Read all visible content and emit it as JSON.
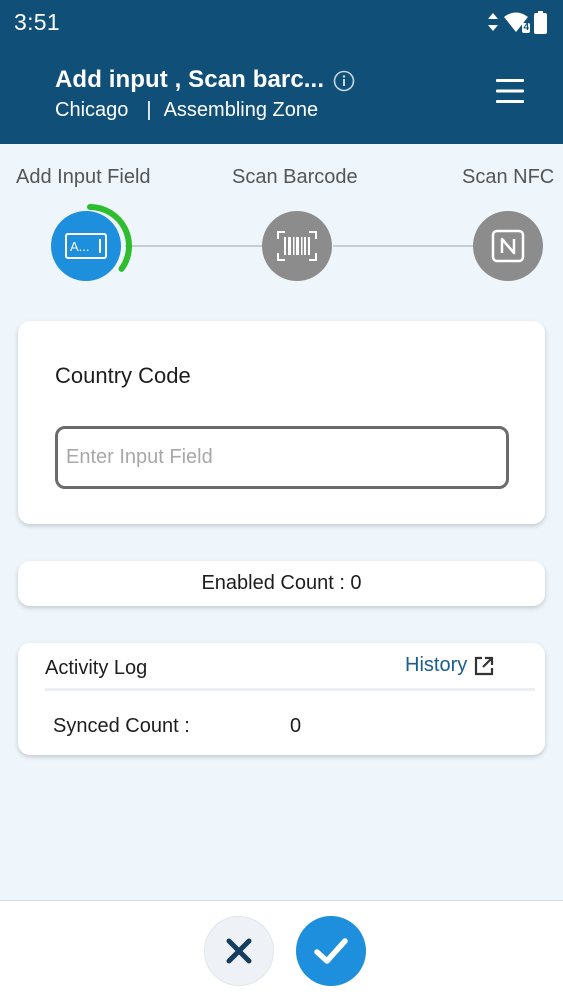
{
  "status_bar": {
    "time": "3:51",
    "network_badge": "4",
    "icons": [
      "data-arrows-icon",
      "wifi-icon",
      "battery-icon"
    ]
  },
  "header": {
    "title": "Add input , Scan barc...",
    "location": "Chicago",
    "separator": "|",
    "zone": "Assembling Zone",
    "icons": [
      "info-icon",
      "hamburger-menu-icon"
    ]
  },
  "stepper": {
    "steps": [
      {
        "label": "Add Input Field",
        "icon": "input-field-icon",
        "active": true
      },
      {
        "label": "Scan Barcode",
        "icon": "barcode-icon",
        "active": false
      },
      {
        "label": "Scan NFC",
        "icon": "nfc-icon",
        "active": false
      }
    ],
    "input_glyph": "A...",
    "progress_fraction": 0.35
  },
  "input_card": {
    "label": "Country Code",
    "placeholder": "Enter Input Field",
    "value": ""
  },
  "count_card": {
    "text": "Enabled Count : 0"
  },
  "activity_log": {
    "title": "Activity Log",
    "history_label": "History",
    "synced_label": "Synced Count :",
    "synced_value": "0"
  },
  "footer": {
    "icons": [
      "close-icon",
      "check-icon"
    ]
  },
  "colors": {
    "header_bg": "#0f4f78",
    "accent": "#1d8fdc",
    "progress": "#2ebd2e",
    "inactive_step": "#8c8c8c",
    "link": "#1a5f8c",
    "page_bg": "#eef5fb"
  }
}
